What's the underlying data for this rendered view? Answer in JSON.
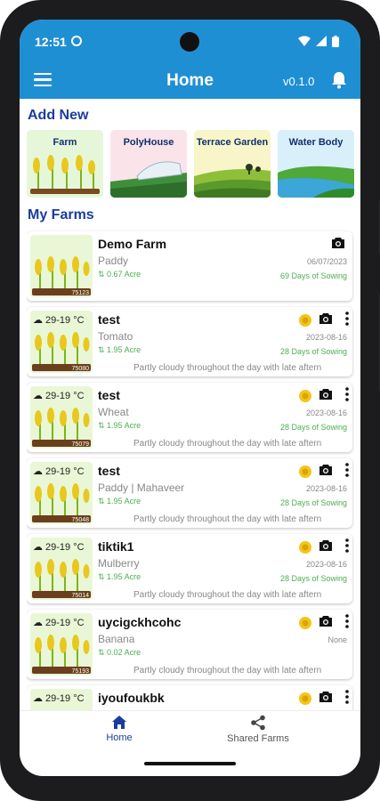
{
  "status_bar": {
    "time": "12:51"
  },
  "app_bar": {
    "title": "Home",
    "version": "v0.1.0",
    "menu_icon": "hamburger-icon",
    "bell_icon": "bell-icon"
  },
  "add_new": {
    "title": "Add New",
    "tiles": [
      {
        "label": "Farm",
        "color": "#e6f7d9"
      },
      {
        "label": "PolyHouse",
        "color": "#fbe3ea"
      },
      {
        "label": "Terrace Garden",
        "color": "#f8f6c8"
      },
      {
        "label": "Water Body",
        "color": "#d9f0fb"
      }
    ]
  },
  "my_farms": {
    "title": "My Farms",
    "farms": [
      {
        "name": "Demo Farm",
        "crop": "Paddy",
        "area": "0.67 Acre",
        "date": "06/07/2023",
        "days": "69 Days of Sowing",
        "thumb_id": "75123",
        "temp": "",
        "weather": ""
      },
      {
        "name": "test",
        "crop": "Tomato",
        "area": "1.95 Acre",
        "date": "2023-08-16",
        "days": "28 Days of Sowing",
        "thumb_id": "75080",
        "temp": "29-19 °C",
        "weather": "Partly cloudy throughout the day with late aftern"
      },
      {
        "name": "test",
        "crop": "Wheat",
        "area": "1.95 Acre",
        "date": "2023-08-16",
        "days": "28 Days of Sowing",
        "thumb_id": "75079",
        "temp": "29-19 °C",
        "weather": "Partly cloudy throughout the day with late aftern"
      },
      {
        "name": "test",
        "crop": "Paddy | Mahaveer",
        "area": "1.95 Acre",
        "date": "2023-08-16",
        "days": "28 Days of Sowing",
        "thumb_id": "75048",
        "temp": "29-19 °C",
        "weather": "Partly cloudy throughout the day with late aftern"
      },
      {
        "name": "tiktik1",
        "crop": "Mulberry",
        "area": "1.95 Acre",
        "date": "2023-08-16",
        "days": "28 Days of Sowing",
        "thumb_id": "75014",
        "temp": "29-19 °C",
        "weather": "Partly cloudy throughout the day with late aftern"
      },
      {
        "name": "uycigckhcohc",
        "crop": "Banana",
        "area": "0.02 Acre",
        "date": "None",
        "days": "",
        "thumb_id": "75193",
        "temp": "29-19 °C",
        "weather": "Partly cloudy throughout the day with late aftern"
      },
      {
        "name": "iyoufoukbk",
        "crop": "",
        "area": "",
        "date": "",
        "days": "",
        "thumb_id": "",
        "temp": "29-19 °C",
        "weather": ""
      }
    ]
  },
  "bottom_nav": {
    "home_label": "Home",
    "shared_label": "Shared Farms"
  },
  "colors": {
    "primary": "#1f8fd4",
    "heading": "#1a3d9e",
    "accent_green": "#4caf50",
    "coin": "#f5c518"
  }
}
